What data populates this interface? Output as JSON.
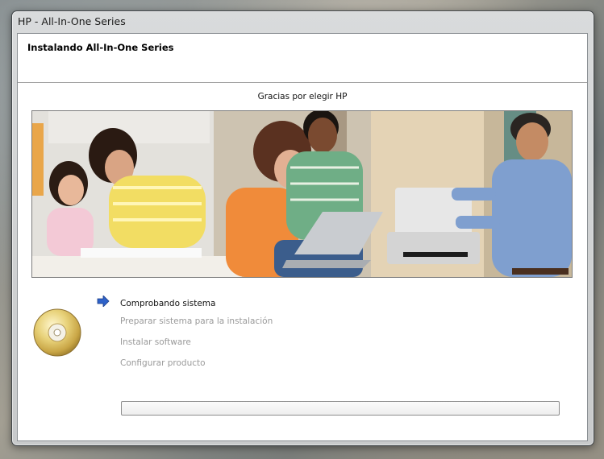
{
  "window": {
    "title": "HP - All-In-One Series"
  },
  "header": {
    "title": "Instalando All-In-One Series"
  },
  "tagline": "Gracias por elegir HP",
  "steps": [
    {
      "label": "Comprobando sistema",
      "state": "active"
    },
    {
      "label": "Preparar sistema para la instalación",
      "state": "pending"
    },
    {
      "label": "Instalar software",
      "state": "pending"
    },
    {
      "label": "Configurar producto",
      "state": "pending"
    }
  ],
  "progress": {
    "fraction": 0
  },
  "icons": {
    "disc": "cd-icon",
    "current_step": "arrow-right-icon"
  },
  "colors": {
    "active_text": "#111111",
    "pending_text": "#9a9a9a",
    "arrow": "#2e62c9"
  }
}
